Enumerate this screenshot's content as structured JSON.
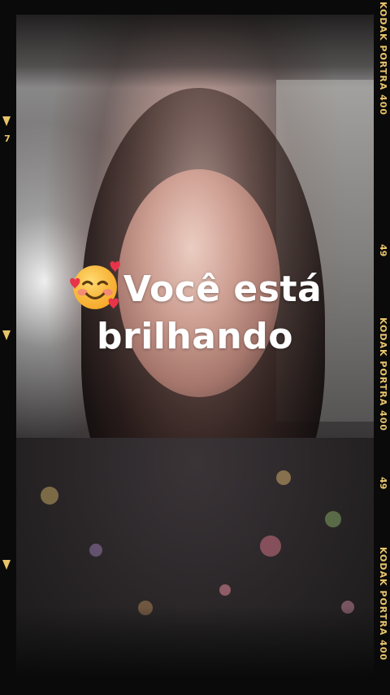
{
  "story": {
    "caption_line1": "Você está",
    "caption_line2": "brilhando",
    "caption_emoji": "smiling-face-with-hearts-icon"
  },
  "film_strip": {
    "edge_label": "KODAK PORTRA 400",
    "frame_number": "49",
    "left_number": "7",
    "accent_color": "#e8c46a"
  }
}
